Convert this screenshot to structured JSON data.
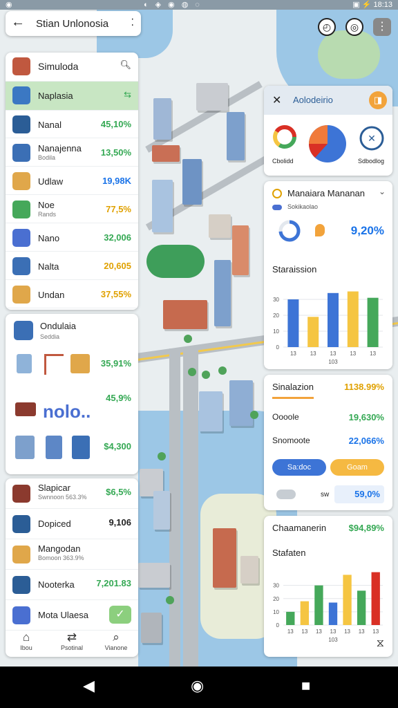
{
  "status": {
    "left": "◉",
    "middle": "◐◈◉◍◌",
    "time": "18:13",
    "icons": "▣ ⚡"
  },
  "topbar": {
    "back_icon": "←",
    "title": "Stian Unlonosia",
    "more_icon": "⁚"
  },
  "map_controls": {
    "compass_icon": "◴",
    "layers_icon": "◎",
    "menu_icon": "⋮"
  },
  "list1": {
    "header": {
      "title": "Simuloda",
      "search_icon": "🔍︎"
    },
    "selected": {
      "label": "Naplasia",
      "icon_right": "⇆"
    },
    "items": [
      {
        "name": "Nanal",
        "value": "45,10%",
        "color": "green"
      },
      {
        "name": "Nanajenna",
        "sub": "Bodila",
        "value": "13,50%",
        "color": "green"
      },
      {
        "name": "Udlaw",
        "value": "19,98K",
        "color": "blue"
      },
      {
        "name": "Noe",
        "sub": "Rands",
        "value": "77,5%",
        "color": "gold"
      },
      {
        "name": "Nano",
        "value": "32,006",
        "color": "green"
      },
      {
        "name": "Nalta",
        "value": "20,605",
        "color": "gold"
      },
      {
        "name": "Undan",
        "value": "37,55%",
        "color": "gold"
      }
    ]
  },
  "list2": {
    "title": "Ondulaia",
    "sub": "Seddia",
    "row_a_value": "35,91%",
    "row_b_value": "45,9%",
    "row_b_text": "nolo..",
    "row_c_value": "$4,300"
  },
  "list3": {
    "items": [
      {
        "name": "Slapicar",
        "sub": "Swnnoon 563.3%",
        "value": "$6,5%",
        "color": "green"
      },
      {
        "name": "Dopiced",
        "value": "9,106",
        "color": "dark"
      },
      {
        "name": "Mangodan",
        "sub": "Bomoon 363.9%",
        "value": "",
        "color": "dark"
      },
      {
        "name": "Nooterka",
        "value": "7,201.83",
        "color": "green"
      },
      {
        "name": "Mota Ulaesa",
        "value": "✓",
        "color": "green"
      }
    ]
  },
  "bottom_tabs": [
    {
      "icon": "⌂",
      "label": "Ibou"
    },
    {
      "icon": "⇄",
      "label": "Psotinal"
    },
    {
      "icon": "⌕",
      "label": "Vianone"
    }
  ],
  "right1": {
    "title": "Aolodeirio",
    "close_icon": "✕",
    "badge_icon": "◨",
    "stats": [
      {
        "label": "Cbolidd"
      },
      {
        "label": "Sdbodlog"
      }
    ]
  },
  "right2": {
    "title": "Manaiara Mananan",
    "subtitle": "Sokikaolao",
    "value": "9,20%",
    "chart_title": "Staraission",
    "chart_data": {
      "type": "bar",
      "categories": [
        "13",
        "13",
        "13",
        "13",
        "13"
      ],
      "values": [
        30,
        19,
        34,
        35,
        31
      ],
      "yticks": [
        "0",
        "10",
        "20",
        "30"
      ],
      "ylim": [
        0,
        40
      ],
      "xlabel": "103",
      "colors": [
        "#3d74d6",
        "#f5c542",
        "#3d74d6",
        "#f5c542",
        "#45a85a"
      ]
    }
  },
  "right3": {
    "title": "Sinalazion",
    "title_value": "1138.99%",
    "rows": [
      {
        "label": "Oooole",
        "value": "19,630%"
      },
      {
        "label": "Snomoote",
        "value": "22,066%"
      }
    ],
    "btn_blue": "Sa:doc",
    "btn_orange": "Goam",
    "summary_value": "59,0%",
    "summary_prefix": "sw"
  },
  "right4": {
    "title": "Chaamanerin",
    "title_value": "$94,89%",
    "chart_title": "Stafaten",
    "chart_data": {
      "type": "bar",
      "categories": [
        "13",
        "13",
        "13",
        "13",
        "13",
        "13",
        "13"
      ],
      "values": [
        10,
        18,
        30,
        17,
        38,
        26,
        40
      ],
      "yticks": [
        "0",
        "10",
        "20",
        "30"
      ],
      "ylim": [
        0,
        45
      ],
      "xlabel": "103",
      "colors": [
        "#45a85a",
        "#f5c542",
        "#45a85a",
        "#3d74d6",
        "#f5c542",
        "#45a85a",
        "#d93025"
      ]
    },
    "corner_icon": "⧖"
  },
  "nav": {
    "back": "◀",
    "home": "◉",
    "recents": "■"
  }
}
